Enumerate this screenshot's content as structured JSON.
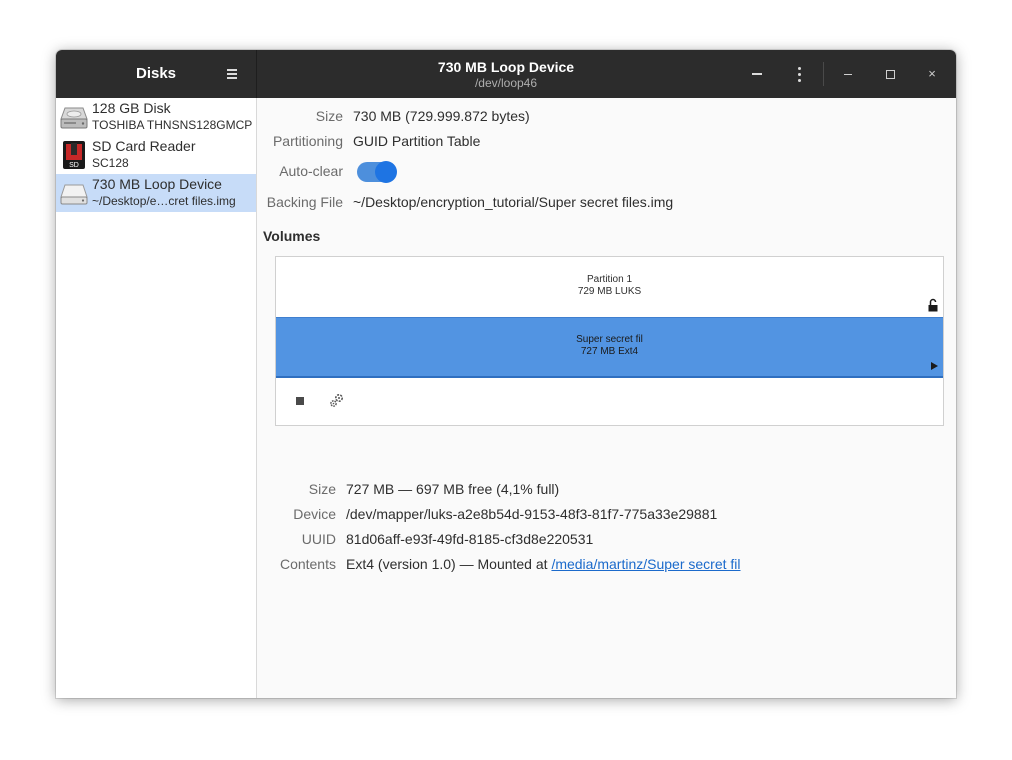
{
  "sidebar": {
    "title": "Disks",
    "disks": [
      {
        "name": "128 GB Disk",
        "sub": "TOSHIBA THNSNS128GMCP"
      },
      {
        "name": "SD Card Reader",
        "sub": "SC128"
      },
      {
        "name": "730 MB Loop Device",
        "sub": "~/Desktop/e…cret files.img"
      }
    ],
    "sd_icon_label": "SD"
  },
  "header": {
    "title": "730 MB Loop Device",
    "subtitle": "/dev/loop46",
    "close_glyph": "×"
  },
  "drive": {
    "size_label": "Size",
    "size_value": "730 MB (729.999.872 bytes)",
    "partitioning_label": "Partitioning",
    "partitioning_value": "GUID Partition Table",
    "autoclear_label": "Auto-clear",
    "autoclear_on": true,
    "backing_label": "Backing File",
    "backing_value": "~/Desktop/encryption_tutorial/Super secret files.img"
  },
  "volumes": {
    "title": "Volumes",
    "partition_name": "Partition 1",
    "partition_detail": "729 MB LUKS",
    "inner_name": "Super secret fil",
    "inner_detail": "727 MB Ext4"
  },
  "volume_info": {
    "size_label": "Size",
    "size_value": "727 MB — 697 MB free (4,1% full)",
    "device_label": "Device",
    "device_value": "/dev/mapper/luks-a2e8b54d-9153-48f3-81f7-775a33e29881",
    "uuid_label": "UUID",
    "uuid_value": "81d06aff-e93f-49fd-8185-cf3d8e220531",
    "contents_label": "Contents",
    "contents_value": "Ext4 (version 1.0) — Mounted at ",
    "mount_link": "/media/martinz/Super secret fil"
  },
  "colors": {
    "headerbar": "#2c2c2c",
    "selection": "#c7dcf8",
    "accent": "#1e74e3",
    "volume_blue": "#5294e2",
    "link": "#1b6acb"
  }
}
